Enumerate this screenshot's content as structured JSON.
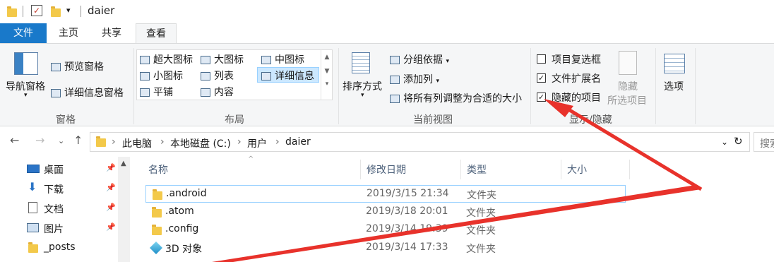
{
  "window": {
    "title": "daier"
  },
  "tabs": [
    {
      "label": "文件"
    },
    {
      "label": "主页"
    },
    {
      "label": "共享"
    },
    {
      "label": "查看"
    }
  ],
  "ribbon": {
    "panes": {
      "nav_pane": "导航窗格",
      "preview_pane": "预览窗格",
      "details_pane": "详细信息窗格",
      "group_label": "窗格"
    },
    "layout": {
      "items": [
        "超大图标",
        "大图标",
        "中图标",
        "小图标",
        "列表",
        "详细信息",
        "平铺",
        "内容"
      ],
      "group_label": "布局"
    },
    "current_view": {
      "sort_by": "排序方式",
      "group_by": "分组依据",
      "add_column": "添加列",
      "fit_columns": "将所有列调整为合适的大小",
      "group_label": "当前视图"
    },
    "show_hide": {
      "item_checkboxes": "项目复选框",
      "file_extensions": "文件扩展名",
      "hidden_items": "隐藏的项目",
      "hide_selected_l1": "隐藏",
      "hide_selected_l2": "所选项目",
      "group_label": "显示/隐藏",
      "checks": {
        "item_checkboxes": false,
        "file_extensions": true,
        "hidden_items": true
      }
    },
    "options": "选项"
  },
  "address": {
    "crumbs": [
      "此电脑",
      "本地磁盘 (C:)",
      "用户",
      "daier"
    ],
    "search_placeholder": "搜索"
  },
  "nav_pane": [
    {
      "label": "桌面",
      "icon": "desktop-icon"
    },
    {
      "label": "下载",
      "icon": "download-icon"
    },
    {
      "label": "文档",
      "icon": "document-icon"
    },
    {
      "label": "图片",
      "icon": "picture-icon"
    },
    {
      "label": "_posts",
      "icon": "folder-icon"
    }
  ],
  "columns": [
    "名称",
    "修改日期",
    "类型",
    "大小"
  ],
  "files": [
    {
      "name": ".android",
      "date": "2019/3/15 21:34",
      "type": "文件夹"
    },
    {
      "name": ".atom",
      "date": "2019/3/18 20:01",
      "type": "文件夹"
    },
    {
      "name": ".config",
      "date": "2019/3/14 19:39",
      "type": "文件夹"
    },
    {
      "name": "3D 对象",
      "date": "2019/3/14 17:33",
      "type": "文件夹"
    }
  ],
  "colors": {
    "accent": "#1979ca",
    "annotation": "#e8322b"
  }
}
